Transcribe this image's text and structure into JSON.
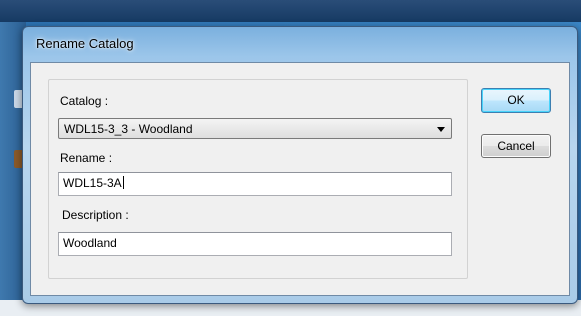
{
  "dialog": {
    "title": "Rename Catalog",
    "catalog_label": "Catalog :",
    "catalog_selected": "WDL15-3_3 - Woodland",
    "rename_label": "Rename :",
    "rename_value": "WDL15-3A",
    "description_label": "Description :",
    "description_value": "Woodland",
    "ok_label": "OK",
    "cancel_label": "Cancel"
  },
  "colors": {
    "ok_accent": "#3c7fb1",
    "title_bar": "#9cc6ea"
  }
}
